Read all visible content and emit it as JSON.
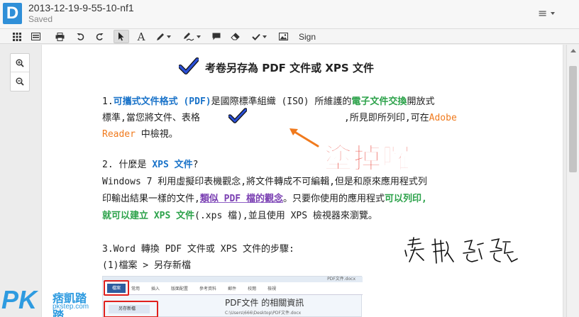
{
  "app": {
    "logo_letter": "D",
    "doc_title": "2013-12-19-9-55-10-nf1",
    "status": "Saved"
  },
  "toolbar": {
    "sign_label": "Sign",
    "text_tool_label": "A"
  },
  "document": {
    "heading": "考卷另存為 PDF 文件或 XPS 文件",
    "p1": {
      "num": "1.",
      "term": "可攜式文件格式 (PDF)",
      "mid": "是國際標準組織 (ISO) 所維護的",
      "green": "電子文件交換",
      "end": "開放式",
      "line2a": "標準,當您將文件、表格",
      "line2b": ",所見即所列印,可在",
      "adobe": "Adobe",
      "line3a": "Reader",
      "line3b": "中檢視。"
    },
    "p2": {
      "num": "2. 什麼是",
      "term": "XPS 文件",
      "q": "?",
      "line2": "Windows 7 利用虛擬印表機觀念,將文件轉成不可編輯,但是和原來應用程式列",
      "line3a": "印輸出結果一樣的文件,",
      "line3purple": "類似 PDF 檔的觀念",
      "line3b": "。只要你使用的應用程式",
      "line3green": "可以列印,",
      "line4green": "就可以建立 XPS 文件",
      "line4b": "(.xps 檔),並且使用 XPS 檢視器來瀏覽。"
    },
    "p3": {
      "line1": "3.Word 轉換 PDF 文件或 XPS 文件的步驟:",
      "line2": "(1)檔案 > 另存新檔"
    },
    "stamp": "塗掉囉",
    "embedded": {
      "titlebar": "PDF文件.docx",
      "tabs": [
        "檔案",
        "常用",
        "插入",
        "版面配置",
        "參考資料",
        "郵件",
        "校閱",
        "檢視"
      ],
      "file_tab": "檔案",
      "side_item": "另存新檔",
      "info": "PDF文件 的相關資訊",
      "path": "C:\\Users\\666\\Desktop\\PDF文件.docx"
    }
  },
  "watermark": {
    "pk": "PK",
    "cn": "痞凱踏踏",
    "sub": "pkstep.com"
  },
  "colors": {
    "logo": "#2f8fd8",
    "link_blue": "#1a73c9",
    "green": "#2ca24a",
    "orange": "#f07a1d",
    "stamp_red": "#e8443a",
    "arrow": "#f07a1d",
    "check": "#2a4fd6"
  }
}
